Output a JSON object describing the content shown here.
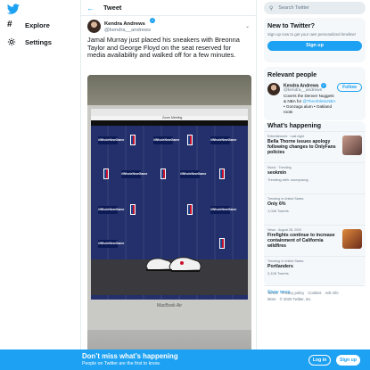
{
  "brand": {
    "accent": "#1da1f2",
    "logo": "twitter-bird-icon"
  },
  "nav": {
    "items": [
      {
        "label": "Explore",
        "icon": "hash-icon"
      },
      {
        "label": "Settings",
        "icon": "gear-icon"
      }
    ]
  },
  "tweet": {
    "header_title": "Tweet",
    "author": {
      "name": "Kendra Andrews",
      "handle": "@kendra__andrews"
    },
    "text": "Jamal Murray just placed his sneakers with Breonna Taylor and George Floyd on the seat reserved for media availability and walked off for a few minutes.",
    "media": {
      "screen_bar_text": "Zoom Meeting",
      "laptop_label": "MacBook Air",
      "backdrop_tag": "#WholeNewGame"
    }
  },
  "search": {
    "placeholder": "Search Twitter"
  },
  "new_to_twitter": {
    "title": "New to Twitter?",
    "subtitle": "Sign up now to get your own personalized timeline!",
    "button": "Sign up"
  },
  "relevant": {
    "title": "Relevant people",
    "person": {
      "name": "Kendra Andrews",
      "handle": "@kendra__andrews",
      "bio_prefix": "Covers the Denver Nuggets & NBA for ",
      "bio_mention": "@TheAthleticNBA",
      "bio_suffix": " • Gonzaga alum • Oakland roots",
      "follow": "Follow"
    }
  },
  "happening": {
    "title": "What’s happening",
    "trends": [
      {
        "context": "Entertainment · Last night",
        "name": "Bella Thorne issues apology following changes to OnlyFans policies",
        "sub": ""
      },
      {
        "context": "Music · Trending",
        "name": "seokmin",
        "sub": "Trending with: soonyoung"
      },
      {
        "context": "Trending in United States",
        "name": "Only 6%",
        "sub": "1,046 Tweets"
      },
      {
        "context": "News · August 28, 2020",
        "name": "Firefights continue to increase containment of California wildfires",
        "sub": ""
      },
      {
        "context": "Trending in United States",
        "name": "Portlanders",
        "sub": "3,108 Tweets"
      }
    ],
    "show_more": "Show more"
  },
  "footer": {
    "links": [
      "Terms",
      "Privacy policy",
      "Cookies",
      "Ads info",
      "More"
    ],
    "copyright": "© 2020 Twitter, Inc."
  },
  "bottom_bar": {
    "title": "Don’t miss what’s happening",
    "subtitle": "People on Twitter are the first to know.",
    "login": "Log in",
    "signup": "Sign up"
  }
}
